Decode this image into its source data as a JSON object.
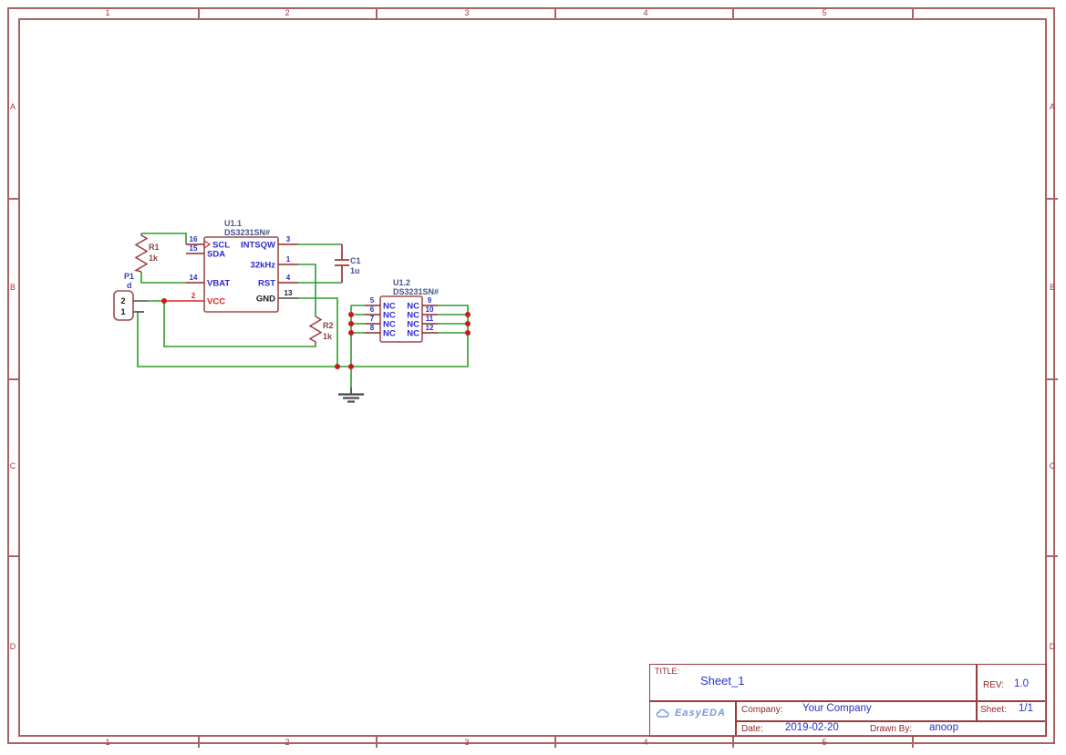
{
  "frame": {
    "cols": [
      "1",
      "2",
      "3",
      "4",
      "5"
    ],
    "rows": [
      "A",
      "B",
      "C",
      "D"
    ]
  },
  "schematic": {
    "u1_1": {
      "ref": "U1.1",
      "part": "DS3231SN#",
      "left_pins": [
        {
          "num": "16",
          "name": "SCL"
        },
        {
          "num": "15",
          "name": "SDA"
        },
        {
          "num": "14",
          "name": "VBAT"
        },
        {
          "num": "2",
          "name": "VCC"
        }
      ],
      "right_pins": [
        {
          "num": "3",
          "name": "INTSQW"
        },
        {
          "num": "1",
          "name": "32kHz"
        },
        {
          "num": "4",
          "name": "RST"
        },
        {
          "num": "13",
          "name": "GND"
        }
      ]
    },
    "u1_2": {
      "ref": "U1.2",
      "part": "DS3231SN#",
      "left_pins": [
        {
          "num": "5",
          "name": "NC"
        },
        {
          "num": "6",
          "name": "NC"
        },
        {
          "num": "7",
          "name": "NC"
        },
        {
          "num": "8",
          "name": "NC"
        }
      ],
      "right_pins": [
        {
          "num": "9",
          "name": "NC"
        },
        {
          "num": "10",
          "name": "NC"
        },
        {
          "num": "11",
          "name": "NC"
        },
        {
          "num": "12",
          "name": "NC"
        }
      ]
    },
    "r1": {
      "ref": "R1",
      "value": "1k"
    },
    "r2": {
      "ref": "R2",
      "value": "1k"
    },
    "c1": {
      "ref": "C1",
      "value": "1u"
    },
    "p1": {
      "ref": "P1",
      "value": "d",
      "pin_labels": [
        "2",
        "1"
      ]
    }
  },
  "title_block": {
    "title_label": "TITLE:",
    "title": "Sheet_1",
    "rev_label": "REV:",
    "rev": "1.0",
    "company_label": "Company:",
    "company": "Your Company",
    "sheet_label": "Sheet:",
    "sheet": "1/1",
    "date_label": "Date:",
    "date": "2019-02-20",
    "drawn_by_label": "Drawn By:",
    "drawn_by": "anoop",
    "logo": "EasyEDA"
  },
  "colors": {
    "wire_green": "#2e9b2e",
    "junction_red": "#c81919",
    "symbol_stroke": "#a14b4b",
    "pin_stub": "#8b2a2a",
    "frame_border": "#ad6262",
    "label_maroon": "#8f2727",
    "value_blue": "#2533cc",
    "pin_text_blue": "#2b2bd0",
    "logo_blue": "#7b99d6"
  }
}
